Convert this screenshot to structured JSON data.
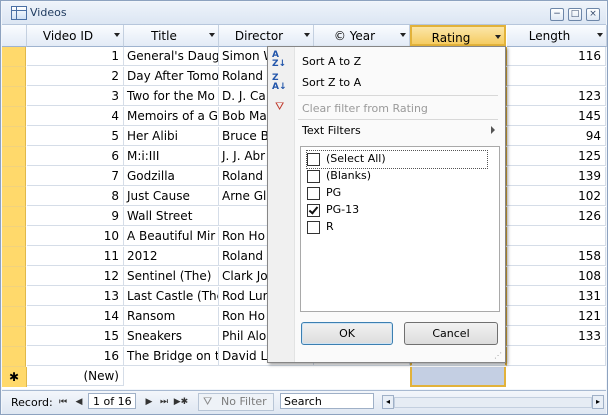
{
  "window": {
    "title": "Videos",
    "minimize": "−",
    "restore": "□",
    "close": "×"
  },
  "columns": [
    {
      "label": "Video ID"
    },
    {
      "label": "Title"
    },
    {
      "label": "Director"
    },
    {
      "label": "© Year"
    },
    {
      "label": "Rating"
    },
    {
      "label": "Length"
    }
  ],
  "rows": [
    {
      "id": "1",
      "title": "General's Daug",
      "director": "Simon W",
      "length": "116"
    },
    {
      "id": "2",
      "title": "Day After Tomo",
      "director": "Roland",
      "length": ""
    },
    {
      "id": "3",
      "title": "Two for the Mo",
      "director": "D. J. Ca",
      "length": "123"
    },
    {
      "id": "4",
      "title": "Memoirs of a G",
      "director": "Bob Ma",
      "length": "145"
    },
    {
      "id": "5",
      "title": "Her Alibi",
      "director": "Bruce B",
      "length": "94"
    },
    {
      "id": "6",
      "title": "M:i:III",
      "director": "J. J. Abr",
      "length": "125"
    },
    {
      "id": "7",
      "title": "Godzilla",
      "director": "Roland",
      "length": "139"
    },
    {
      "id": "8",
      "title": "Just Cause",
      "director": "Arne Gl",
      "length": "102"
    },
    {
      "id": "9",
      "title": "Wall Street",
      "director": "",
      "length": "126"
    },
    {
      "id": "10",
      "title": "A Beautiful Mir",
      "director": "Ron Ho",
      "length": ""
    },
    {
      "id": "11",
      "title": "2012",
      "director": "Roland",
      "length": "158"
    },
    {
      "id": "12",
      "title": "Sentinel (The)",
      "director": "Clark Jo",
      "length": "108"
    },
    {
      "id": "13",
      "title": "Last Castle (The",
      "director": "Rod Lur",
      "length": "131"
    },
    {
      "id": "14",
      "title": "Ransom",
      "director": "Ron Ho",
      "length": "121"
    },
    {
      "id": "15",
      "title": "Sneakers",
      "director": "Phil Alo",
      "length": "133"
    },
    {
      "id": "16",
      "title": "The Bridge on t",
      "director": "David L",
      "length": ""
    }
  ],
  "new_row": {
    "marker": "✱",
    "label": "(New)"
  },
  "statusbar": {
    "record_label": "Record:",
    "position": "1 of 16",
    "filter_label": "No Filter",
    "search_placeholder": "Search",
    "first": "⏮",
    "prev": "◀",
    "next": "▶",
    "last": "⏭",
    "new": "▶✱"
  },
  "filter_menu": {
    "sort_asc": "Sort A to Z",
    "sort_desc": "Sort Z to A",
    "clear_filter": "Clear filter from Rating",
    "text_filters": "Text Filters",
    "options": [
      {
        "label": "(Select All)",
        "checked": false
      },
      {
        "label": "(Blanks)",
        "checked": false
      },
      {
        "label": "PG",
        "checked": false
      },
      {
        "label": "PG-13",
        "checked": true
      },
      {
        "label": "R",
        "checked": false
      }
    ],
    "ok": "OK",
    "cancel": "Cancel"
  },
  "colors": {
    "accent_selected": "#ffd96b",
    "chrome": "#dce6f3"
  }
}
